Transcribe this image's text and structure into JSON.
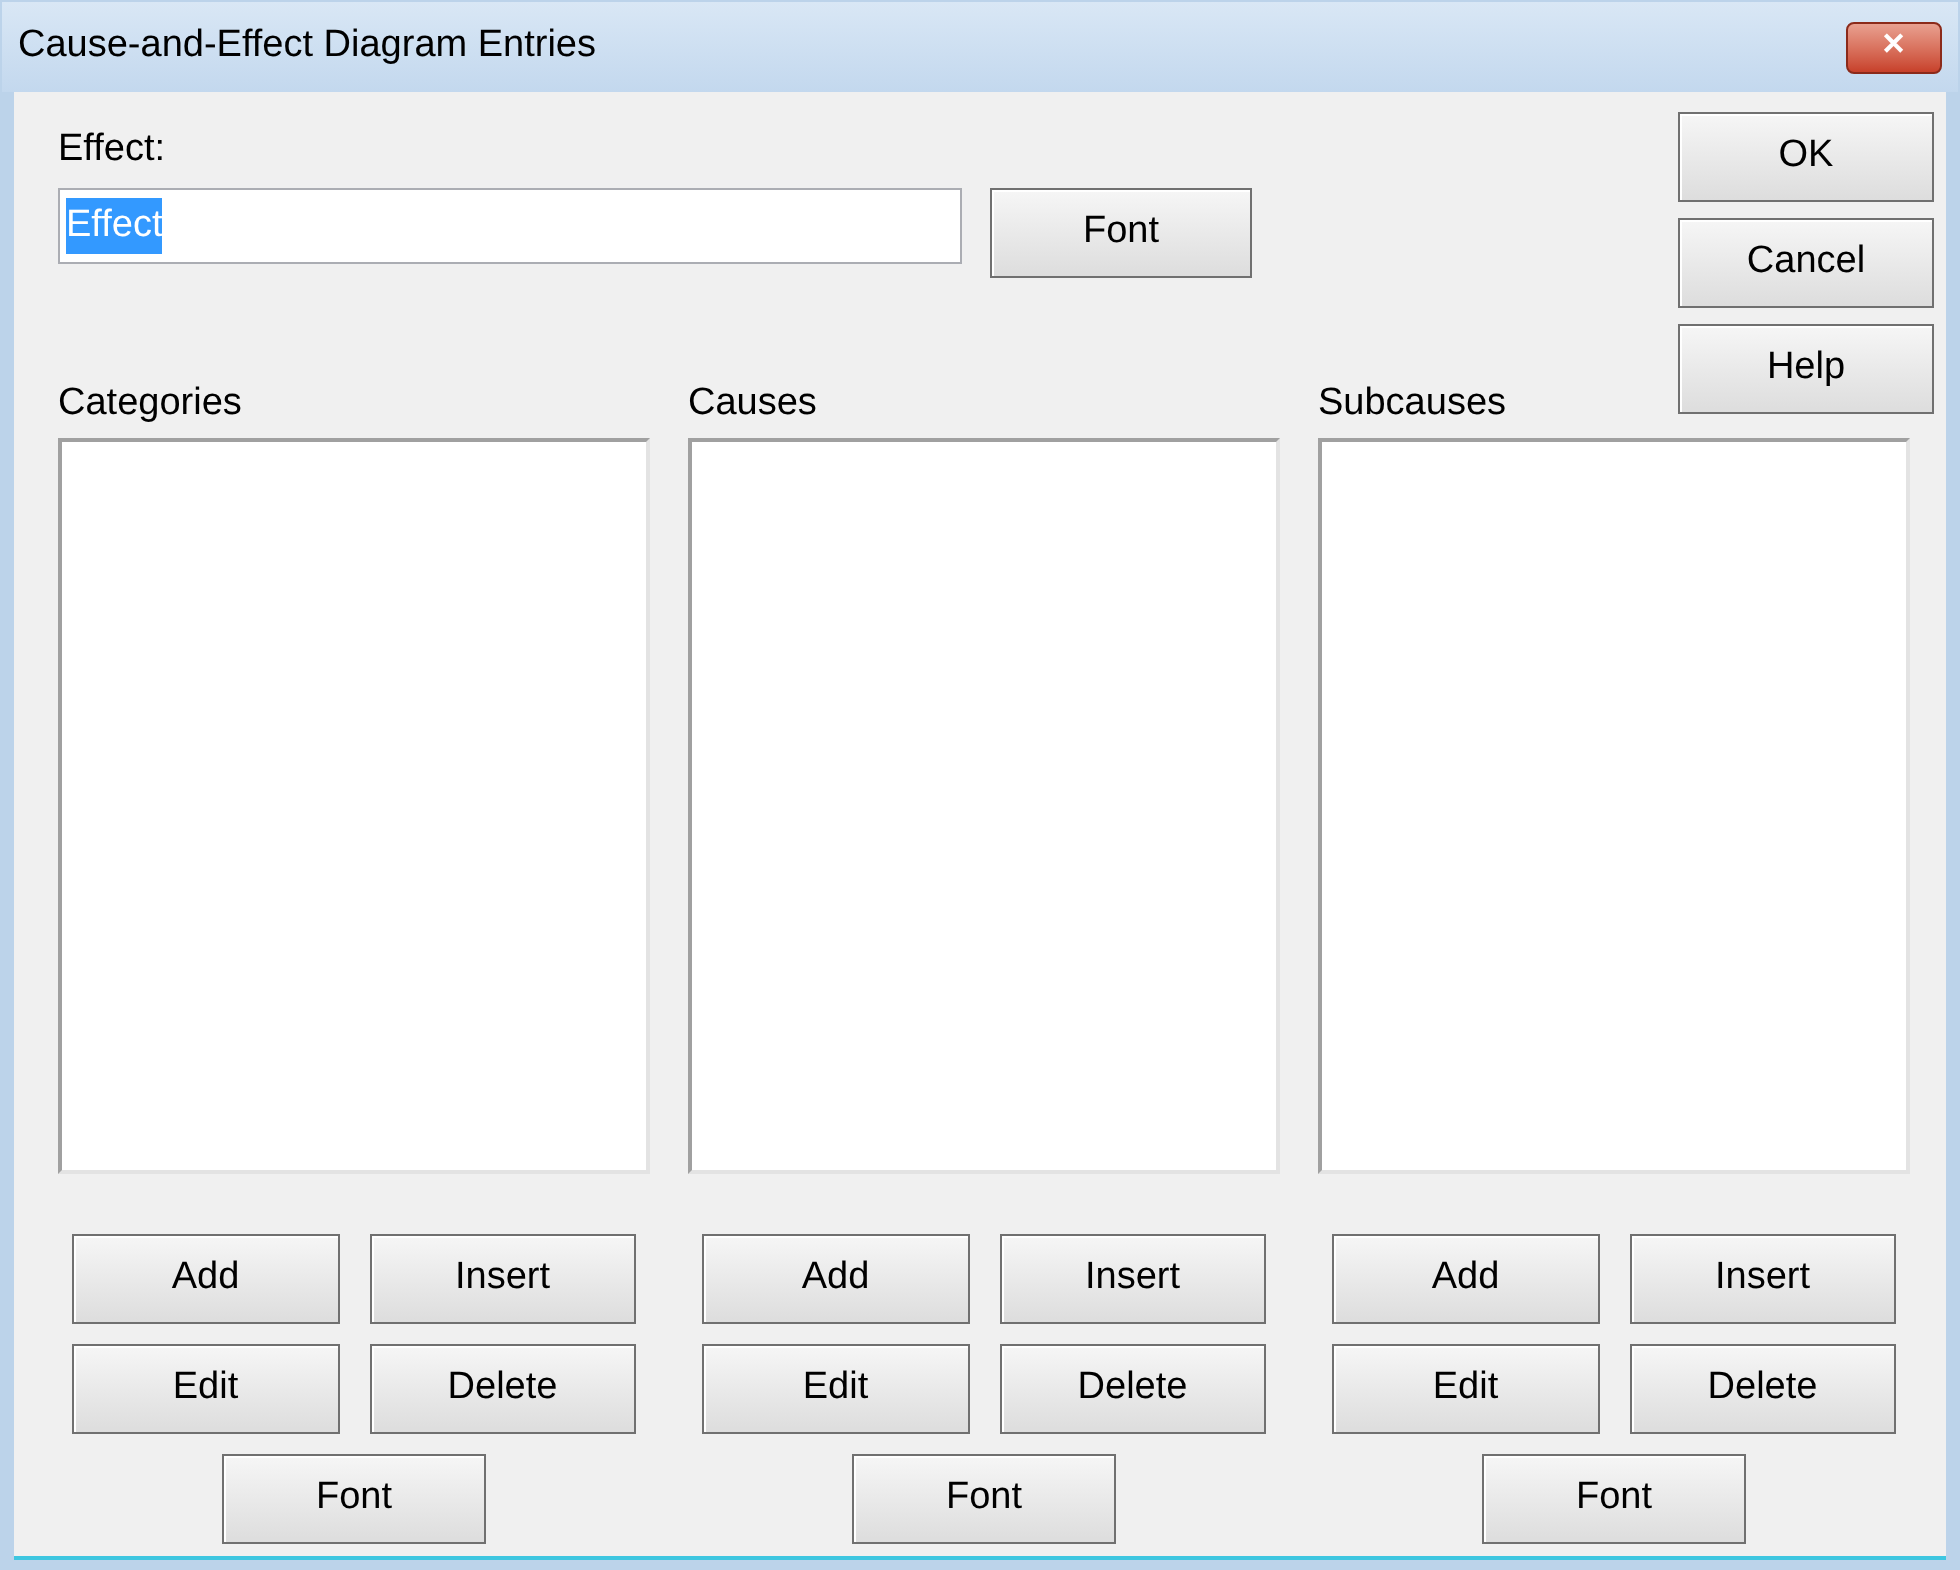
{
  "window": {
    "title": "Cause-and-Effect Diagram Entries",
    "close": "✕"
  },
  "effect": {
    "label": "Effect:",
    "value": "Effect",
    "selected": true,
    "font_button": "Font"
  },
  "dialog_buttons": [
    "OK",
    "Cancel",
    "Help"
  ],
  "columns": [
    {
      "label": "Categories",
      "buttons": [
        "Add",
        "Insert",
        "Edit",
        "Delete"
      ],
      "font_button": "Font"
    },
    {
      "label": "Causes",
      "buttons": [
        "Add",
        "Insert",
        "Edit",
        "Delete"
      ],
      "font_button": "Font"
    },
    {
      "label": "Subcauses",
      "buttons": [
        "Add",
        "Insert",
        "Edit",
        "Delete"
      ],
      "font_button": "Font"
    }
  ]
}
